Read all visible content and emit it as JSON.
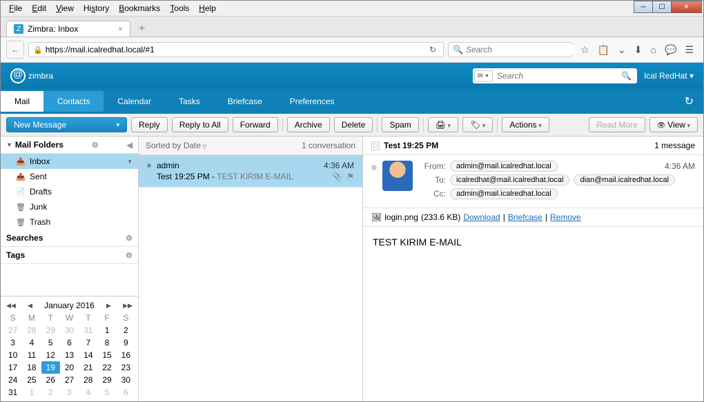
{
  "menubar": [
    "File",
    "Edit",
    "View",
    "History",
    "Bookmarks",
    "Tools",
    "Help"
  ],
  "tab": {
    "title": "Zimbra: Inbox"
  },
  "url": "https://mail.icalredhat.local/#1",
  "browser_search_placeholder": "Search",
  "zimbra": {
    "logo": "zimbra",
    "search_placeholder": "Search",
    "user": "Ical RedHat",
    "tabs": [
      "Mail",
      "Contacts",
      "Calendar",
      "Tasks",
      "Briefcase",
      "Preferences"
    ]
  },
  "toolbar": {
    "new_message": "New Message",
    "reply": "Reply",
    "reply_all": "Reply to All",
    "forward": "Forward",
    "archive": "Archive",
    "delete": "Delete",
    "spam": "Spam",
    "actions": "Actions",
    "read_more": "Read More",
    "view": "View"
  },
  "sidebar": {
    "folders_label": "Mail Folders",
    "items": [
      {
        "icon": "📥",
        "label": "Inbox",
        "sel": true,
        "arr": true
      },
      {
        "icon": "📤",
        "label": "Sent"
      },
      {
        "icon": "📄",
        "label": "Drafts"
      },
      {
        "icon": "🗑",
        "label": "Junk"
      },
      {
        "icon": "🗑",
        "label": "Trash"
      }
    ],
    "searches": "Searches",
    "tags": "Tags"
  },
  "calendar": {
    "title": "January 2016",
    "dow": [
      "S",
      "M",
      "T",
      "W",
      "T",
      "F",
      "S"
    ],
    "prev": [
      27,
      28,
      29,
      30,
      31
    ],
    "days": 31,
    "today": 19,
    "next": [
      1,
      2,
      3,
      4,
      5,
      6
    ]
  },
  "msglist": {
    "sort_label": "Sorted by Date",
    "count": "1 conversation",
    "items": [
      {
        "from": "admin",
        "time": "4:36 AM",
        "subject": "Test 19:25 PM",
        "fragment": "TEST KIRIM E-MAIL"
      }
    ]
  },
  "reader": {
    "subject": "Test 19:25 PM",
    "count": "1 message",
    "from_label": "From:",
    "from": "admin@mail.icalredhat.local",
    "time": "4:36 AM",
    "to_label": "To:",
    "to": [
      "icalredhat@mail.icalredhat.local",
      "dian@mail.icalredhat.local"
    ],
    "cc_label": "Cc:",
    "cc": "admin@mail.icalredhat.local",
    "attachment": {
      "name": "login.png",
      "size": "(233.6 KB)",
      "download": "Download",
      "briefcase": "Briefcase",
      "remove": "Remove"
    },
    "body": "TEST KIRIM E-MAIL"
  }
}
